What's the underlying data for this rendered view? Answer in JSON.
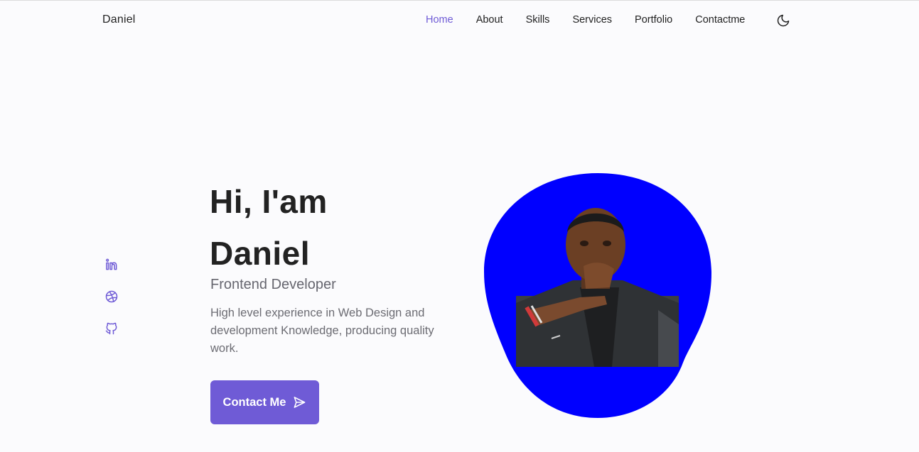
{
  "header": {
    "logo": "Daniel",
    "nav": [
      "Home",
      "About",
      "Skills",
      "Services",
      "Portfolio",
      "Contactme"
    ],
    "active": "Home",
    "theme_icon": "moon-icon"
  },
  "social": [
    {
      "name": "linkedin",
      "icon": "linkedin-icon"
    },
    {
      "name": "dribbble",
      "icon": "dribbble-icon"
    },
    {
      "name": "github",
      "icon": "github-icon"
    }
  ],
  "hero": {
    "title_line1": "Hi, I'am",
    "title_line2": "Daniel",
    "subtitle": "Frontend Developer",
    "description": "High level experience in Web Design and development Knowledge, producing quality work.",
    "cta_label": "Contact Me",
    "cta_icon": "send-icon"
  },
  "colors": {
    "accent": "#6f5bd6",
    "blob": "#0000ff",
    "background": "#fbfbfd"
  }
}
